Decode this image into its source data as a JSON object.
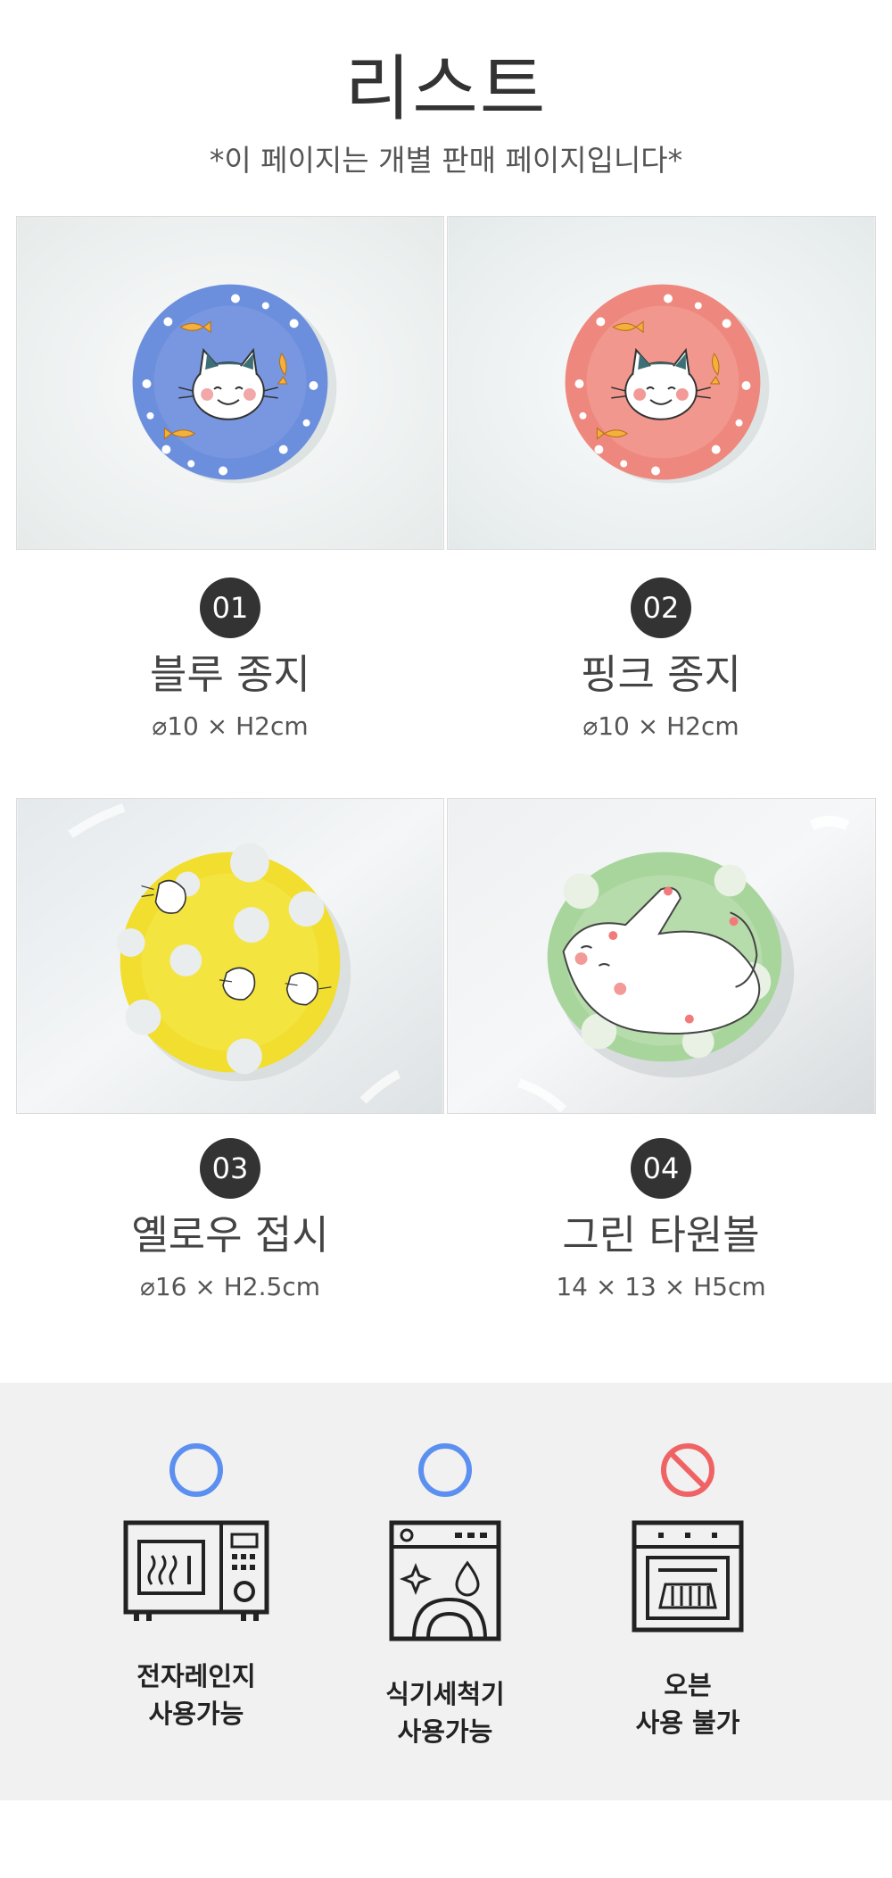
{
  "header": {
    "title": "리스트",
    "subtitle": "*이 페이지는 개별 판매 페이지입니다*"
  },
  "products": [
    {
      "number": "01",
      "name": "블루 종지",
      "size": "⌀10 × H2cm",
      "color": "#6d8fdc"
    },
    {
      "number": "02",
      "name": "핑크 종지",
      "size": "⌀10 × H2cm",
      "color": "#ee8a80"
    },
    {
      "number": "03",
      "name": "옐로우 접시",
      "size": "⌀16 × H2.5cm",
      "color": "#f2e038"
    },
    {
      "number": "04",
      "name": "그린 타원볼",
      "size": "14 × 13 × H5cm",
      "color": "#a6d39a"
    }
  ],
  "care": [
    {
      "icon": "microwave-icon",
      "status": "allowed",
      "line1": "전자레인지",
      "line2": "사용가능"
    },
    {
      "icon": "dishwasher-icon",
      "status": "allowed",
      "line1": "식기세척기",
      "line2": "사용가능"
    },
    {
      "icon": "oven-icon",
      "status": "not-allowed",
      "line1": "오븐",
      "line2": "사용 불가"
    }
  ],
  "colors": {
    "allowed": "#5b8ff0",
    "not_allowed": "#f06364",
    "badge": "#333333"
  }
}
